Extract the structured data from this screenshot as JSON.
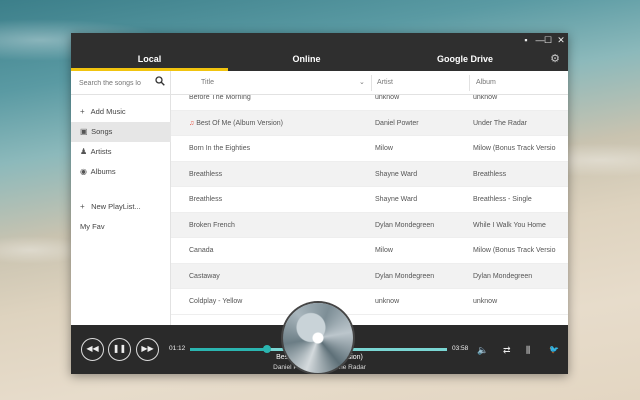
{
  "window": {
    "controls": [
      "▪",
      "—",
      "☐",
      "✕"
    ]
  },
  "tabs": [
    {
      "label": "Local",
      "active": true
    },
    {
      "label": "Online",
      "active": false
    },
    {
      "label": "Google Drive",
      "active": false
    }
  ],
  "tab_accent": "#f1c40f",
  "search": {
    "placeholder": "Search the songs lo"
  },
  "sidebar": {
    "items": [
      {
        "label": "Add Music",
        "icon": "plus-icon",
        "glyph": "+"
      },
      {
        "label": "Songs",
        "icon": "songs-icon",
        "glyph": "▣",
        "active": true
      },
      {
        "label": "Artists",
        "icon": "artists-icon",
        "glyph": "♟"
      },
      {
        "label": "Albums",
        "icon": "albums-icon",
        "glyph": "◉"
      },
      {
        "label": "New PlayList...",
        "icon": "plus-icon",
        "glyph": "+"
      },
      {
        "label": "My Fav",
        "icon": "",
        "glyph": ""
      }
    ]
  },
  "table": {
    "columns": [
      "Title",
      "Artist",
      "Album"
    ],
    "sort_glyph": "⌄",
    "rows": [
      {
        "title": "Before The Morning",
        "artist": "unknow",
        "album": "unknow",
        "playing": false
      },
      {
        "title": "Best Of Me (Album Version)",
        "artist": "Daniel Powter",
        "album": "Under The Radar",
        "playing": true
      },
      {
        "title": "Born In the Eighties",
        "artist": "Milow",
        "album": "Milow (Bonus Track Versio",
        "playing": false
      },
      {
        "title": "Breathless",
        "artist": "Shayne Ward",
        "album": "Breathless",
        "playing": false
      },
      {
        "title": "Breathless",
        "artist": "Shayne Ward",
        "album": "Breathless - Single",
        "playing": false
      },
      {
        "title": "Broken French",
        "artist": "Dylan Mondegreen",
        "album": "While I Walk You Home",
        "playing": false
      },
      {
        "title": "Canada",
        "artist": "Milow",
        "album": "Milow (Bonus Track Versio",
        "playing": false
      },
      {
        "title": "Castaway",
        "artist": "Dylan Mondegreen",
        "album": "Dylan Mondegreen",
        "playing": false
      },
      {
        "title": "Coldplay - Yellow",
        "artist": "unknow",
        "album": "unknow",
        "playing": false
      }
    ],
    "playing_color": "#e74c3c",
    "playing_glyph": "♫"
  },
  "player": {
    "elapsed": "01:12",
    "duration": "03:58",
    "progress": 0.3,
    "accent": "#2bb5b0",
    "now_playing_title": "Best Of Me (Album Version)",
    "now_playing_sub": "Daniel Powter-Under The Radar",
    "buttons": {
      "prev": "◀◀",
      "play": "❚❚",
      "next": "▶▶"
    },
    "icons": {
      "volume": "🔈",
      "repeat": "⇄",
      "equalizer": "⫼",
      "share": "🐦"
    }
  }
}
